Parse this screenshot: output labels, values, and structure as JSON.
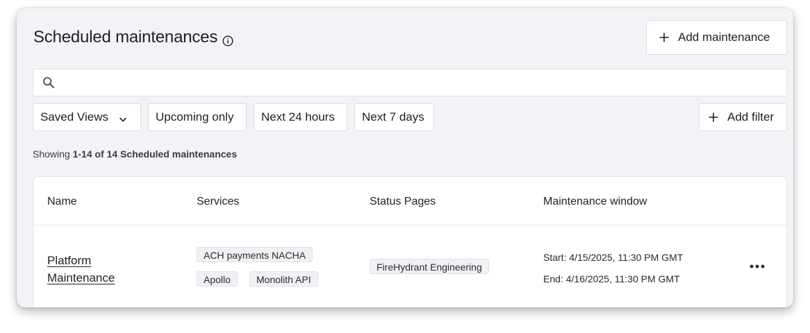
{
  "header": {
    "title": "Scheduled maintenances",
    "add_maintenance_label": "Add maintenance"
  },
  "search": {
    "placeholder": "",
    "value": ""
  },
  "filters": {
    "saved_views_label": "Saved Views",
    "quick_filters": [
      "Upcoming only",
      "Next 24 hours",
      "Next 7 days"
    ],
    "add_filter_label": "Add filter"
  },
  "summary": {
    "prefix": "Showing",
    "range": "1-14 of 14 Scheduled maintenances"
  },
  "table": {
    "columns": [
      "Name",
      "Services",
      "Status Pages",
      "Maintenance window"
    ],
    "rows": [
      {
        "name": "Platform Maintenance",
        "services": [
          "ACH payments NACHA",
          "Apollo",
          "Monolith API"
        ],
        "status_pages": [
          "FireHydrant Engineering"
        ],
        "start": "Start: 4/15/2025, 11:30 PM GMT",
        "end": "End: 4/16/2025, 11:30 PM GMT"
      }
    ]
  },
  "icons": {
    "info": "info-circle-icon",
    "add": "plus-icon",
    "search": "magnifier-icon",
    "saved_views": "chevron-down-icon",
    "row_actions": "more-horizontal-icon"
  },
  "colors": {
    "panel_bg": "#f2f3f6",
    "card_bg": "#ffffff",
    "border": "#dcdde3",
    "text": "#1f1f24",
    "tag_bg": "#f0f1f4"
  }
}
